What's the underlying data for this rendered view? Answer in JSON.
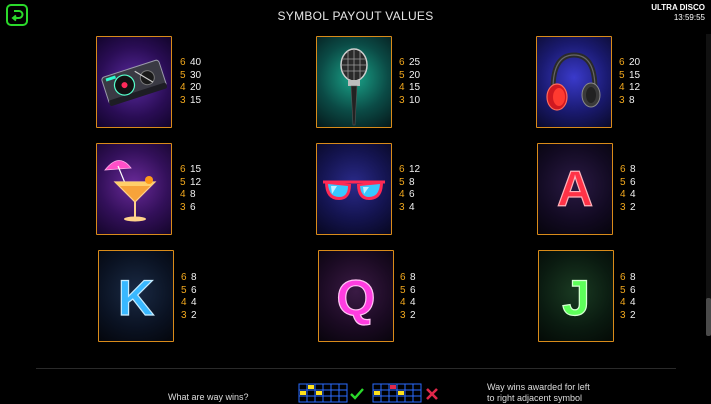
{
  "header": {
    "title": "SYMBOL PAYOUT VALUES",
    "game_name": "ULTRA DISCO",
    "clock": "13:59:55"
  },
  "symbols": [
    {
      "name": "turntable",
      "pays": [
        {
          "count": "6",
          "value": "40"
        },
        {
          "count": "5",
          "value": "30"
        },
        {
          "count": "4",
          "value": "20"
        },
        {
          "count": "3",
          "value": "15"
        }
      ]
    },
    {
      "name": "microphone",
      "pays": [
        {
          "count": "6",
          "value": "25"
        },
        {
          "count": "5",
          "value": "20"
        },
        {
          "count": "4",
          "value": "15"
        },
        {
          "count": "3",
          "value": "10"
        }
      ]
    },
    {
      "name": "headphones",
      "pays": [
        {
          "count": "6",
          "value": "20"
        },
        {
          "count": "5",
          "value": "15"
        },
        {
          "count": "4",
          "value": "12"
        },
        {
          "count": "3",
          "value": "8"
        }
      ]
    },
    {
      "name": "cocktail",
      "pays": [
        {
          "count": "6",
          "value": "15"
        },
        {
          "count": "5",
          "value": "12"
        },
        {
          "count": "4",
          "value": "8"
        },
        {
          "count": "3",
          "value": "6"
        }
      ]
    },
    {
      "name": "sunglasses",
      "pays": [
        {
          "count": "6",
          "value": "12"
        },
        {
          "count": "5",
          "value": "8"
        },
        {
          "count": "4",
          "value": "6"
        },
        {
          "count": "3",
          "value": "4"
        }
      ]
    },
    {
      "name": "letter-a",
      "letter": "A",
      "pays": [
        {
          "count": "6",
          "value": "8"
        },
        {
          "count": "5",
          "value": "6"
        },
        {
          "count": "4",
          "value": "4"
        },
        {
          "count": "3",
          "value": "2"
        }
      ]
    },
    {
      "name": "letter-k",
      "letter": "K",
      "pays": [
        {
          "count": "6",
          "value": "8"
        },
        {
          "count": "5",
          "value": "6"
        },
        {
          "count": "4",
          "value": "4"
        },
        {
          "count": "3",
          "value": "2"
        }
      ]
    },
    {
      "name": "letter-q",
      "letter": "Q",
      "pays": [
        {
          "count": "6",
          "value": "8"
        },
        {
          "count": "5",
          "value": "6"
        },
        {
          "count": "4",
          "value": "4"
        },
        {
          "count": "3",
          "value": "2"
        }
      ]
    },
    {
      "name": "letter-j",
      "letter": "J",
      "pays": [
        {
          "count": "6",
          "value": "8"
        },
        {
          "count": "5",
          "value": "6"
        },
        {
          "count": "4",
          "value": "4"
        },
        {
          "count": "3",
          "value": "2"
        }
      ]
    }
  ],
  "footer": {
    "question": "What are way wins?",
    "explanation_line1": "Way wins awarded for left",
    "explanation_line2": "to right adjacent symbol"
  },
  "icons": {
    "back": "back-arrow-icon",
    "valid": "green-check-icon",
    "invalid": "red-cross-icon"
  },
  "colors": {
    "accent_green": "#2bd92b",
    "card_border": "#d98b1a",
    "pay_count": "#f2a81d",
    "neon_red": "#ff3347",
    "neon_cyan": "#39b8ff",
    "neon_pink": "#ff3de0",
    "neon_green": "#5dff5a"
  }
}
